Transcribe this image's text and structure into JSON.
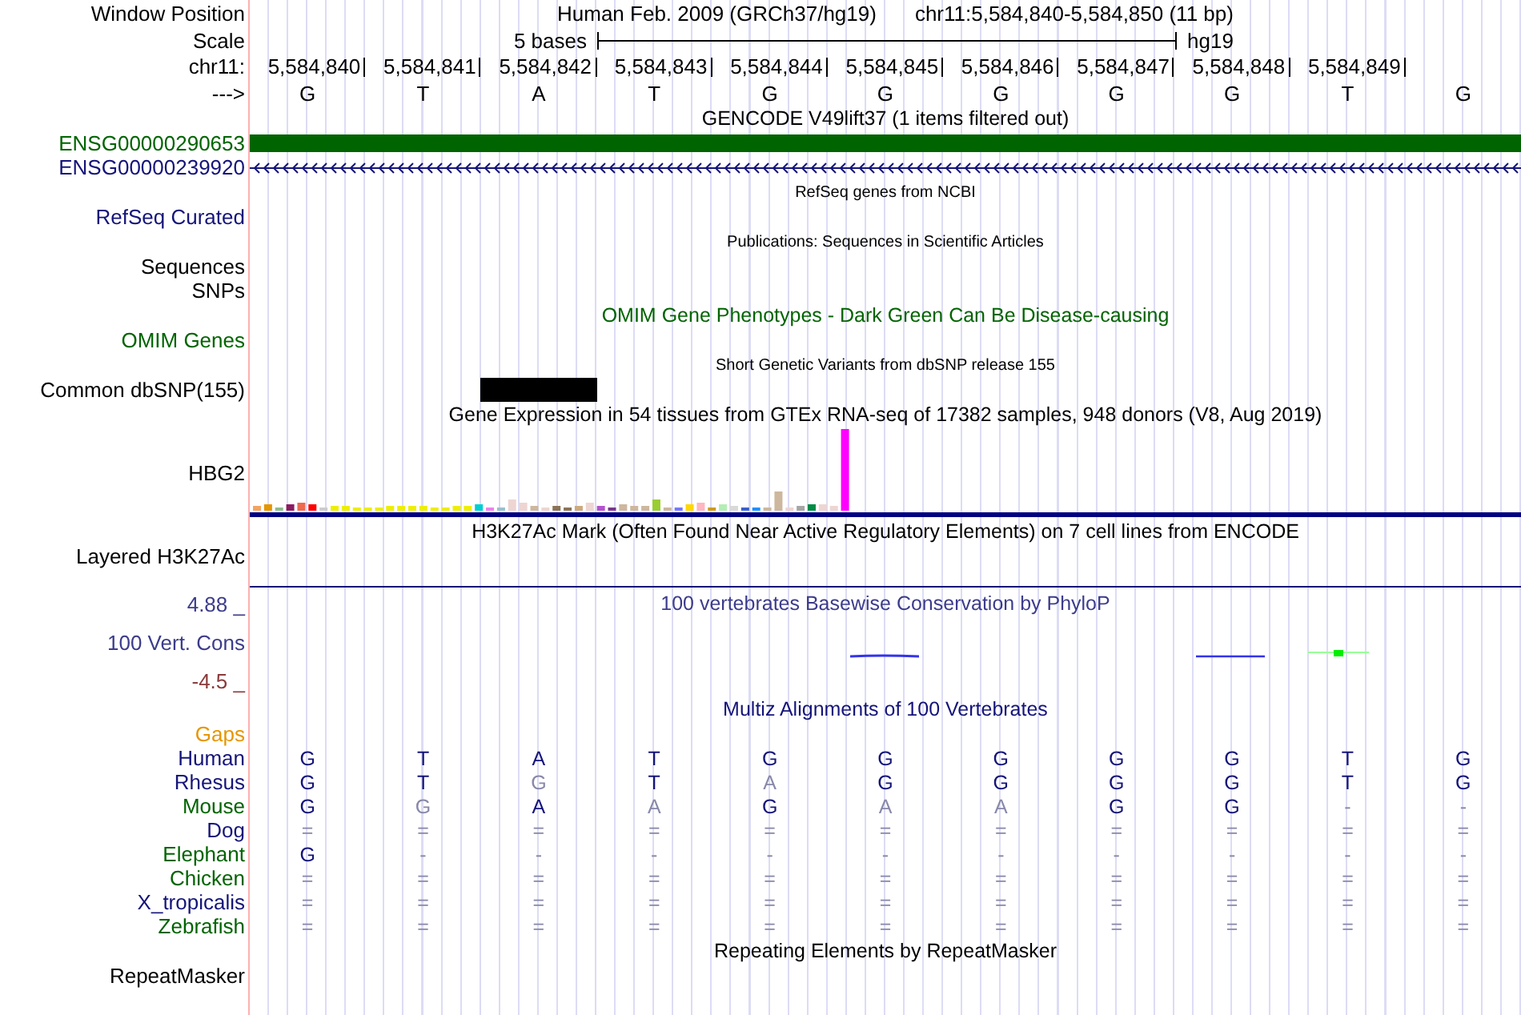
{
  "header": {
    "label": "Window Position",
    "assembly": "Human Feb. 2009 (GRCh37/hg19)",
    "position": "chr11:5,584,840-5,584,850 (11 bp)"
  },
  "scale": {
    "label": "Scale",
    "span": "5 bases",
    "assembly": "hg19"
  },
  "ruler": {
    "label": "chr11:",
    "positions": [
      "5,584,840",
      "5,584,841",
      "5,584,842",
      "5,584,843",
      "5,584,844",
      "5,584,845",
      "5,584,846",
      "5,584,847",
      "5,584,848",
      "5,584,849"
    ]
  },
  "sequence": {
    "label": "--->",
    "bases": [
      "G",
      "T",
      "A",
      "T",
      "G",
      "G",
      "G",
      "G",
      "G",
      "T",
      "G"
    ]
  },
  "tracks": [
    {
      "kind": "title",
      "text": "GENCODE V49lift37 (1 items filtered out)",
      "color": "#000000"
    },
    {
      "kind": "block",
      "label": "ENSG00000290653",
      "color": "#006400"
    },
    {
      "kind": "arrows",
      "label": "ENSG00000239920",
      "color": "#14147a"
    },
    {
      "kind": "caption",
      "text": "RefSeq genes from NCBI"
    },
    {
      "kind": "empty",
      "label": "RefSeq Curated",
      "color": "#14147a"
    },
    {
      "kind": "caption",
      "text": "Publications: Sequences in Scientific Articles"
    },
    {
      "kind": "empty",
      "label": "Sequences",
      "color": "#000000"
    },
    {
      "kind": "empty",
      "label": "SNPs",
      "color": "#000000"
    },
    {
      "kind": "title",
      "text": "OMIM Gene Phenotypes - Dark Green Can Be Disease-causing",
      "color": "#006400"
    },
    {
      "kind": "empty",
      "label": "OMIM Genes",
      "color": "#006400"
    },
    {
      "kind": "caption",
      "text": "Short Genetic Variants from dbSNP release 155"
    },
    {
      "kind": "snp",
      "label": "Common dbSNP(155)",
      "color": "#000000",
      "marks": [
        false,
        false,
        true,
        false,
        false,
        false,
        false,
        false,
        false,
        false,
        false
      ]
    },
    {
      "kind": "title",
      "text": "Gene Expression in 54 tissues from GTEx RNA-seq of 17382 samples, 948 donors (V8, Aug 2019)",
      "color": "#000000"
    },
    {
      "kind": "expression",
      "label": "HBG2",
      "color": "#000000"
    },
    {
      "kind": "title",
      "text": "H3K27Ac Mark (Often Found Near Active Regulatory Elements) on 7 cell lines from ENCODE",
      "color": "#000000"
    },
    {
      "kind": "layered",
      "label": "Layered H3K27Ac",
      "color": "#000000"
    },
    {
      "kind": "conservation",
      "label": "100 Vert. Cons",
      "color": "#3c3c8c",
      "max": "4.88 _",
      "min": "-4.5 _",
      "title": "100 vertebrates Basewise Conservation by PhyloP"
    },
    {
      "kind": "title",
      "text": "Multiz Alignments of 100 Vertebrates",
      "color": "#14147a"
    },
    {
      "kind": "empty",
      "label": "Gaps",
      "color": "#e69500"
    },
    {
      "kind": "species",
      "label": "Human",
      "color": "#14147a",
      "bases": [
        {
          "base": "G",
          "match": true
        },
        {
          "base": "T",
          "match": true
        },
        {
          "base": "A",
          "match": true
        },
        {
          "base": "T",
          "match": true
        },
        {
          "base": "G",
          "match": true
        },
        {
          "base": "G",
          "match": true
        },
        {
          "base": "G",
          "match": true
        },
        {
          "base": "G",
          "match": true
        },
        {
          "base": "G",
          "match": true
        },
        {
          "base": "T",
          "match": true
        },
        {
          "base": "G",
          "match": true
        }
      ]
    },
    {
      "kind": "species",
      "label": "Rhesus",
      "color": "#14147a",
      "bases": [
        {
          "base": "G",
          "match": true
        },
        {
          "base": "T",
          "match": true
        },
        {
          "base": "G",
          "match": false
        },
        {
          "base": "T",
          "match": true
        },
        {
          "base": "A",
          "match": false
        },
        {
          "base": "G",
          "match": true
        },
        {
          "base": "G",
          "match": true
        },
        {
          "base": "G",
          "match": true
        },
        {
          "base": "G",
          "match": true
        },
        {
          "base": "T",
          "match": true
        },
        {
          "base": "G",
          "match": true
        }
      ]
    },
    {
      "kind": "species",
      "label": "Mouse",
      "color": "#006400",
      "bases": [
        {
          "base": "G",
          "match": true
        },
        {
          "base": "G",
          "match": false
        },
        {
          "base": "A",
          "match": true
        },
        {
          "base": "A",
          "match": false
        },
        {
          "base": "G",
          "match": true
        },
        {
          "base": "A",
          "match": false
        },
        {
          "base": "A",
          "match": false
        },
        {
          "base": "G",
          "match": true
        },
        {
          "base": "G",
          "match": true
        },
        {
          "base": "-",
          "match": false
        },
        {
          "base": "-",
          "match": false
        }
      ]
    },
    {
      "kind": "species",
      "label": "Dog",
      "color": "#14147a",
      "bases": [
        {
          "base": "=",
          "match": false
        },
        {
          "base": "=",
          "match": false
        },
        {
          "base": "=",
          "match": false
        },
        {
          "base": "=",
          "match": false
        },
        {
          "base": "=",
          "match": false
        },
        {
          "base": "=",
          "match": false
        },
        {
          "base": "=",
          "match": false
        },
        {
          "base": "=",
          "match": false
        },
        {
          "base": "=",
          "match": false
        },
        {
          "base": "=",
          "match": false
        },
        {
          "base": "=",
          "match": false
        }
      ]
    },
    {
      "kind": "species",
      "label": "Elephant",
      "color": "#006400",
      "bases": [
        {
          "base": "G",
          "match": true
        },
        {
          "base": "-",
          "match": false
        },
        {
          "base": "-",
          "match": false
        },
        {
          "base": "-",
          "match": false
        },
        {
          "base": "-",
          "match": false
        },
        {
          "base": "-",
          "match": false
        },
        {
          "base": "-",
          "match": false
        },
        {
          "base": "-",
          "match": false
        },
        {
          "base": "-",
          "match": false
        },
        {
          "base": "-",
          "match": false
        },
        {
          "base": "-",
          "match": false
        }
      ]
    },
    {
      "kind": "species",
      "label": "Chicken",
      "color": "#006400",
      "bases": [
        {
          "base": "=",
          "match": false
        },
        {
          "base": "=",
          "match": false
        },
        {
          "base": "=",
          "match": false
        },
        {
          "base": "=",
          "match": false
        },
        {
          "base": "=",
          "match": false
        },
        {
          "base": "=",
          "match": false
        },
        {
          "base": "=",
          "match": false
        },
        {
          "base": "=",
          "match": false
        },
        {
          "base": "=",
          "match": false
        },
        {
          "base": "=",
          "match": false
        },
        {
          "base": "=",
          "match": false
        }
      ]
    },
    {
      "kind": "species",
      "label": "X_tropicalis",
      "color": "#14147a",
      "bases": [
        {
          "base": "=",
          "match": false
        },
        {
          "base": "=",
          "match": false
        },
        {
          "base": "=",
          "match": false
        },
        {
          "base": "=",
          "match": false
        },
        {
          "base": "=",
          "match": false
        },
        {
          "base": "=",
          "match": false
        },
        {
          "base": "=",
          "match": false
        },
        {
          "base": "=",
          "match": false
        },
        {
          "base": "=",
          "match": false
        },
        {
          "base": "=",
          "match": false
        },
        {
          "base": "=",
          "match": false
        }
      ]
    },
    {
      "kind": "species",
      "label": "Zebrafish",
      "color": "#006400",
      "bases": [
        {
          "base": "=",
          "match": false
        },
        {
          "base": "=",
          "match": false
        },
        {
          "base": "=",
          "match": false
        },
        {
          "base": "=",
          "match": false
        },
        {
          "base": "=",
          "match": false
        },
        {
          "base": "=",
          "match": false
        },
        {
          "base": "=",
          "match": false
        },
        {
          "base": "=",
          "match": false
        },
        {
          "base": "=",
          "match": false
        },
        {
          "base": "=",
          "match": false
        },
        {
          "base": "=",
          "match": false
        }
      ]
    },
    {
      "kind": "title",
      "text": "Repeating Elements by RepeatMasker",
      "color": "#000000"
    },
    {
      "kind": "empty",
      "label": "RepeatMasker",
      "color": "#000000"
    }
  ]
}
